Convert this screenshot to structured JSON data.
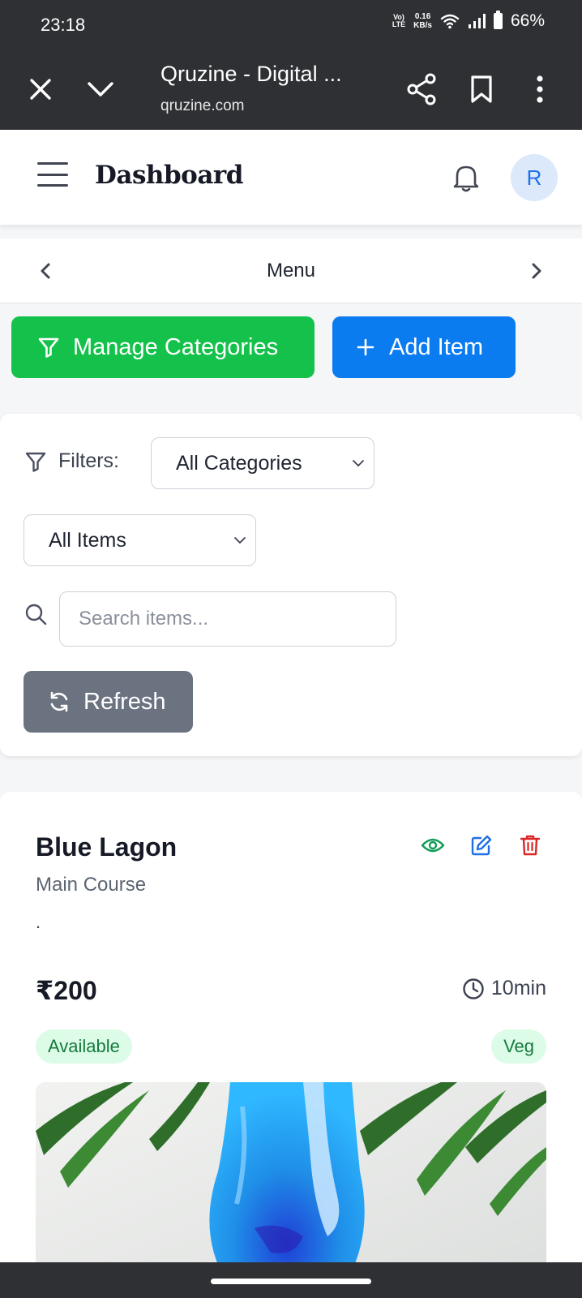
{
  "status_bar": {
    "time": "23:18",
    "network_type_top": "Vo)",
    "network_type_bottom": "LTE",
    "speed_value": "0.16",
    "speed_unit": "KB/s",
    "battery_percent": "66%"
  },
  "browser": {
    "page_title": "Qruzine - Digital ...",
    "url": "qruzine.com"
  },
  "header": {
    "title": "Dashboard",
    "avatar_initial": "R"
  },
  "menu_nav": {
    "label": "Menu"
  },
  "actions": {
    "manage_categories_label": "Manage Categories",
    "add_item_label": "Add Item"
  },
  "filters": {
    "label": "Filters:",
    "category_select": {
      "selected": "All Categories"
    },
    "status_select": {
      "selected": "All Items"
    },
    "search_placeholder": "Search items...",
    "refresh_label": "Refresh"
  },
  "items": [
    {
      "name": "Blue Lagon",
      "category": "Main Course",
      "description": ".",
      "price": "₹200",
      "prep_time": "10min",
      "availability": "Available",
      "diet": "Veg"
    }
  ],
  "colors": {
    "manage_button": "#14c24b",
    "add_button": "#0b7bf0",
    "refresh_button": "#6b7280",
    "view_icon": "#0f9d58",
    "edit_icon": "#1f6fe8",
    "delete_icon": "#dc2626"
  }
}
